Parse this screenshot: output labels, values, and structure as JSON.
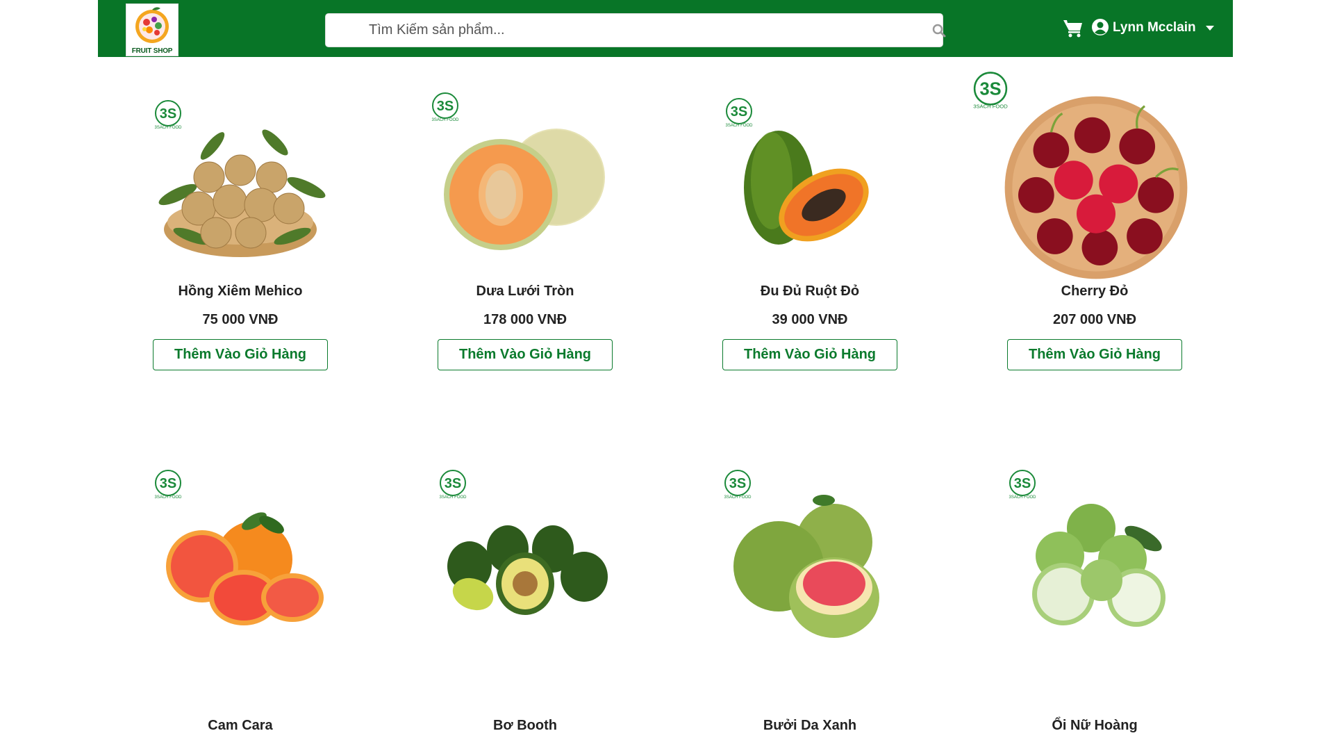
{
  "header": {
    "logo_text": "FRUIT SHOP",
    "search_placeholder": "Tìm Kiếm sản phẩm...",
    "user_name": "Lynn Mcclain"
  },
  "badge_text": "3SACH FOOD",
  "add_to_cart_label": "Thêm Vào Giỏ Hàng",
  "colors": {
    "brand_green": "#087527",
    "button_green": "#0a7a2c"
  },
  "products": [
    {
      "name": "Hồng Xiêm Mehico",
      "price": "75 000 VNĐ",
      "image": "sapodilla-basket"
    },
    {
      "name": "Dưa Lưới Tròn",
      "price": "178 000 VNĐ",
      "image": "cantaloupe"
    },
    {
      "name": "Đu Đủ Ruột Đỏ",
      "price": "39 000 VNĐ",
      "image": "papaya"
    },
    {
      "name": "Cherry Đỏ",
      "price": "207 000 VNĐ",
      "image": "cherry-bowl"
    },
    {
      "name": "Cam Cara",
      "image": "cara-orange"
    },
    {
      "name": "Bơ Booth",
      "image": "avocado"
    },
    {
      "name": "Bưởi Da Xanh",
      "image": "pomelo"
    },
    {
      "name": "Ổi Nữ Hoàng",
      "image": "guava"
    }
  ]
}
